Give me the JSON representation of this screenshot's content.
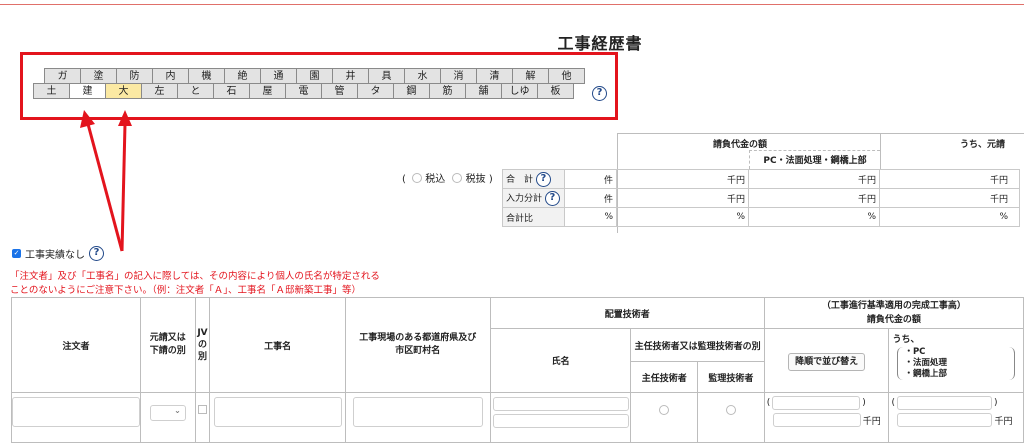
{
  "page": {
    "title": "工事経歴書"
  },
  "tabs": {
    "row1": [
      "ガ",
      "塗",
      "防",
      "内",
      "機",
      "絶",
      "通",
      "園",
      "井",
      "具",
      "水",
      "消",
      "清",
      "解",
      "他"
    ],
    "row2": [
      "土",
      "建",
      "大",
      "左",
      "と",
      "石",
      "屋",
      "電",
      "管",
      "タ",
      "鋼",
      "筋",
      "舗",
      "しゆ",
      "板"
    ]
  },
  "help_label": "?",
  "tax": {
    "open": "(",
    "incl": "税込",
    "excl": "税抜",
    "close": ")"
  },
  "summary": {
    "col_contract": "請負代金の額",
    "col_pc": "PC・法面処理・鋼橋上部",
    "col_uchi": "うち、元請",
    "rows": [
      {
        "label": "合　計",
        "unit1": "件",
        "unit2": "千円",
        "unit3": "千円",
        "unit4": "千円"
      },
      {
        "label": "入力分計",
        "unit1": "件",
        "unit2": "千円",
        "unit3": "千円",
        "unit4": "千円"
      },
      {
        "label": "合計比",
        "unit1": "%",
        "unit2": "%",
        "unit3": "%",
        "unit4": "%"
      }
    ]
  },
  "checkbox": {
    "label": "工事実績なし"
  },
  "notice": {
    "line1": "「注文者」及び「工事名」の記入に際しては、その内容により個人の氏名が特定される",
    "line2": "ことのないようにご注意下さい。（例：注文者「Ａ」、工事名「Ａ邸新築工事」等）"
  },
  "table": {
    "h_orderer": "注文者",
    "h_prime_sub_1": "元請又は",
    "h_prime_sub_2": "下請の別",
    "h_jv_1": "JV",
    "h_jv_2": "の",
    "h_jv_3": "別",
    "h_work_name": "工事名",
    "h_location_1": "工事現場のある都道府県及び",
    "h_location_2": "市区町村名",
    "h_engineers": "配置技術者",
    "h_name": "氏名",
    "h_type": "主任技術者又は監理技術者の別",
    "h_chief": "主任技術者",
    "h_supervisor": "監理技術者",
    "h_progress": "（工事進行基準適用の完成工事高）",
    "h_contract_amount": "請負代金の額",
    "sort_button": "降順で並び替え",
    "h_uchi": "うち、",
    "h_pc1": "・PC",
    "h_pc2": "・法面処理",
    "h_pc3": "・鋼橋上部",
    "paren_open": "(",
    "paren_close": ")",
    "unit_sen": "千円"
  }
}
